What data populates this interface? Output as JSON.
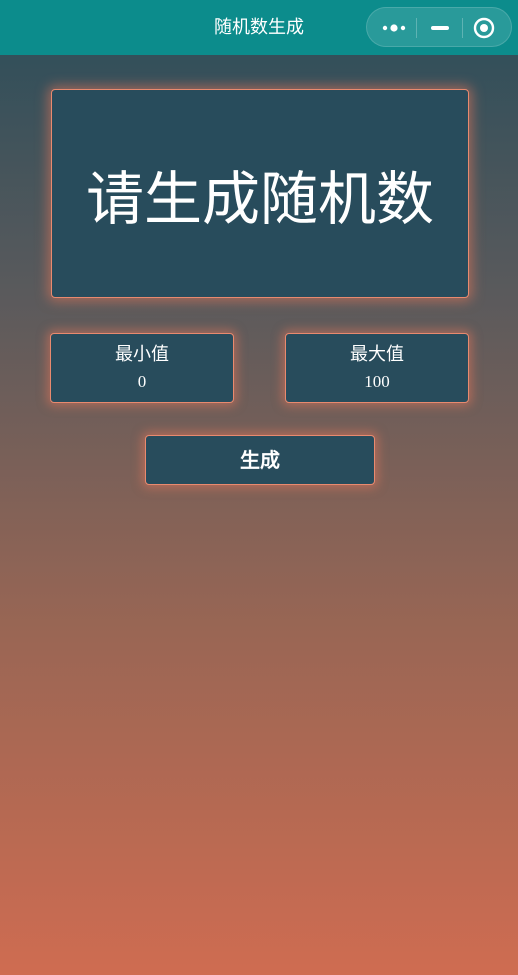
{
  "navbar": {
    "title": "随机数生成",
    "background": "#0c8c8c",
    "capsule": {
      "more_icon": "more-dots-icon",
      "minimize_icon": "minimize-icon",
      "close_icon": "target-close-icon"
    }
  },
  "display": {
    "text": "请生成随机数"
  },
  "range": {
    "min_label": "最小值",
    "min_value": "0",
    "max_label": "最大值",
    "max_value": "100"
  },
  "actions": {
    "generate_label": "生成"
  },
  "colors": {
    "card_bg": "#284c5c",
    "card_border": "#e98a6f",
    "gradient_top": "#2a4d5a",
    "gradient_bottom": "#cf6c51"
  }
}
